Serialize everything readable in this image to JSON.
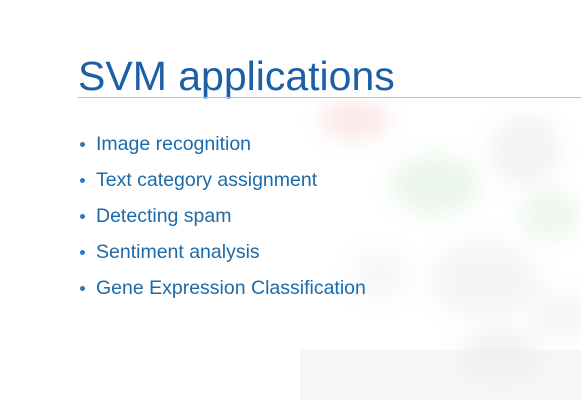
{
  "slide": {
    "title": "SVM applications",
    "bullets": [
      "Image recognition",
      "Text category assignment",
      "Detecting spam",
      "Sentiment analysis",
      "Gene Expression Classification"
    ]
  },
  "colors": {
    "title": "#1c5fa6",
    "bullet_text": "#1c6aa8",
    "rule": "#9ec3e6",
    "background": "#ffffff"
  }
}
